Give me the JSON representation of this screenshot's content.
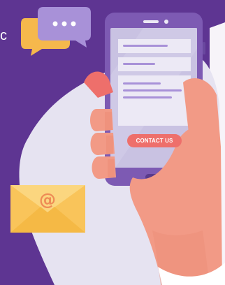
{
  "illustration": {
    "stray_text": "c",
    "contact_label": "CONTACT US",
    "envelope_symbol": "@",
    "chat_dots": "•••",
    "colors": {
      "background": "#5e3592",
      "blob": "#e6e3f1",
      "phone_body": "#7d5ab3",
      "phone_screen": "#c9c2e2",
      "form_field": "#ece9f5",
      "button": "#ee6f6b",
      "skin": "#f29a86",
      "envelope": "#f9c45a",
      "chat_purple": "#a891d8",
      "chat_yellow": "#f6b84c"
    }
  }
}
